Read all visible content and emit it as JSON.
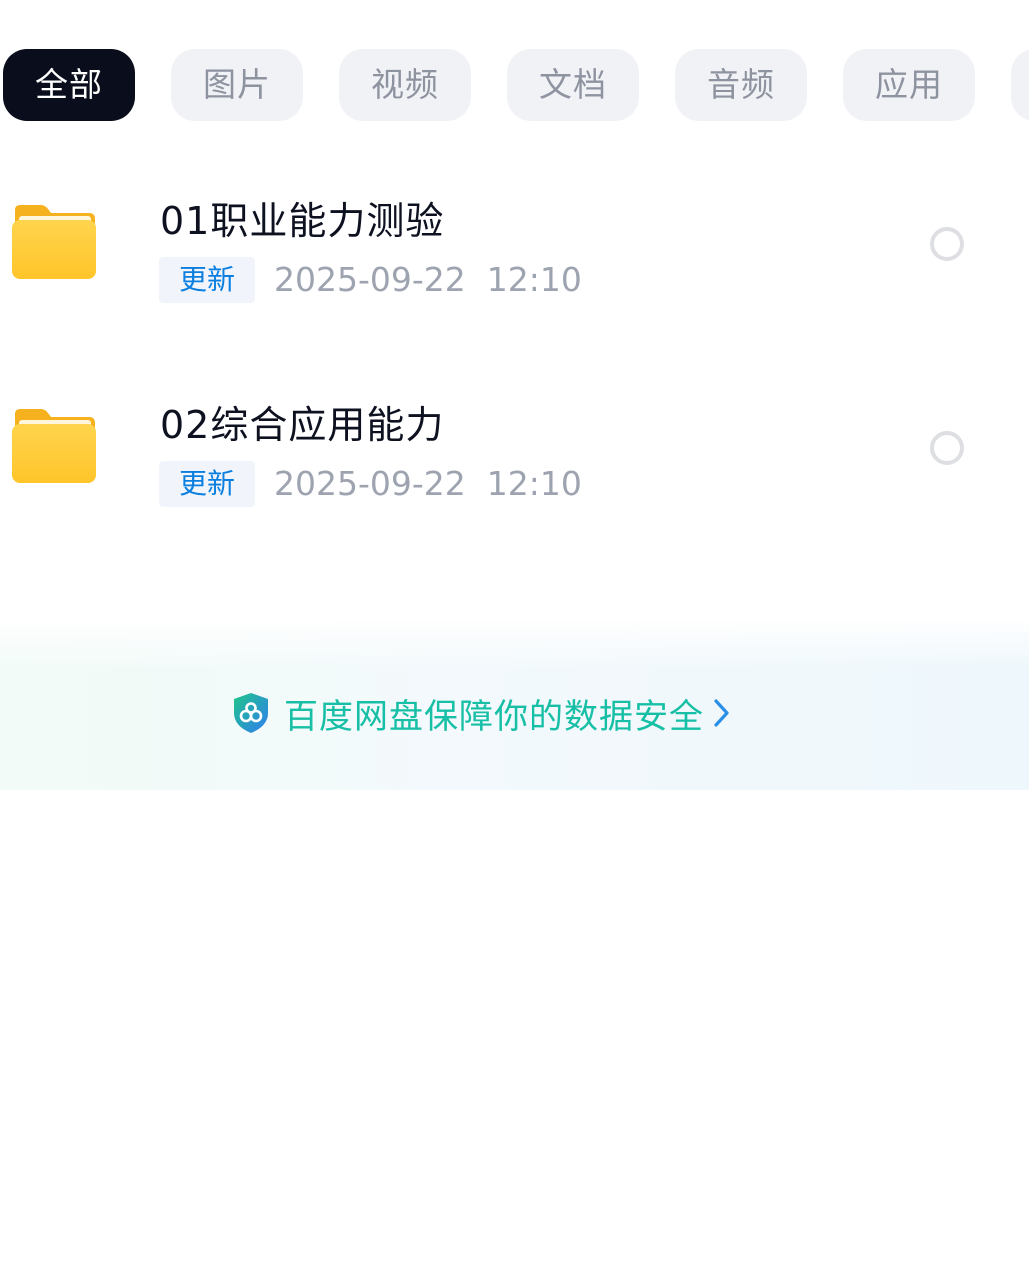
{
  "tabs": [
    {
      "label": "全部",
      "active": true
    },
    {
      "label": "图片",
      "active": false
    },
    {
      "label": "视频",
      "active": false
    },
    {
      "label": "文档",
      "active": false
    },
    {
      "label": "音频",
      "active": false
    },
    {
      "label": "应用",
      "active": false
    }
  ],
  "files": [
    {
      "name": "01职业能力测验",
      "badge": "更新",
      "modified": "2025-09-22  12:10",
      "icon": "folder-icon"
    },
    {
      "name": "02综合应用能力",
      "badge": "更新",
      "modified": "2025-09-22  12:10",
      "icon": "folder-icon"
    }
  ],
  "banner": {
    "text": "百度网盘保障你的数据安全",
    "icon": "shield-icon",
    "arrow_icon": "chevron-right-icon"
  },
  "colors": {
    "active_tab_bg": "#0a0e1c",
    "inactive_tab_bg": "#f1f2f6",
    "badge_text": "#0b7fe0",
    "banner_text": "#16bfa5",
    "folder": "#ffc93a"
  }
}
